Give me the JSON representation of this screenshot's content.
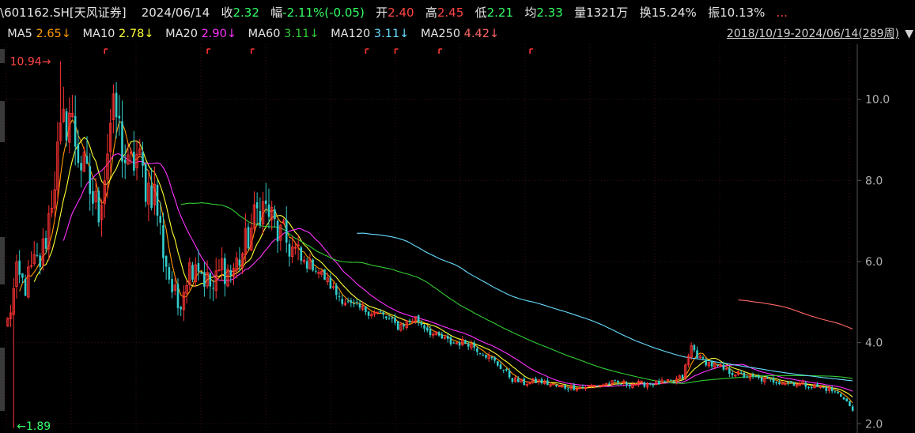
{
  "header": {
    "prefix": "\\",
    "code_name": "601162.SH[天风证券]",
    "date": "2024/06/14",
    "close_label": "收",
    "close_value": "2.32",
    "change_label": "幅",
    "change_value": "-2.11%(-0.05)",
    "open_label": "开",
    "open_value": "2.40",
    "high_label": "高",
    "high_value": "2.45",
    "low_label": "低",
    "low_value": "2.21",
    "avg_label": "均",
    "avg_value": "2.33",
    "volume_label": "量",
    "volume_value": "1321万",
    "turnover_label": "换",
    "turnover_value": "15.24%",
    "amplitude_label": "振",
    "amplitude_value": "10.13%",
    "more": "..."
  },
  "ma_legend": [
    {
      "label": "MA5",
      "value": "2.65↓",
      "color": "#ff9900"
    },
    {
      "label": "MA10",
      "value": "2.78↓",
      "color": "#ffff33"
    },
    {
      "label": "MA20",
      "value": "2.90↓",
      "color": "#ff33ff"
    },
    {
      "label": "MA60",
      "value": "3.11↓",
      "color": "#33cc33"
    },
    {
      "label": "MA120",
      "value": "3.11↓",
      "color": "#66ddff"
    },
    {
      "label": "MA250",
      "value": "4.42↓",
      "color": "#ff6666"
    }
  ],
  "range": {
    "text": "2018/10/19-2024/06/14(289周)",
    "arrow": "▼"
  },
  "chart_data": {
    "type": "candlestick",
    "period": "weekly",
    "bars": 289,
    "ylim": [
      1.85,
      11.2
    ],
    "y_ticks": [
      "10.0",
      "8.0",
      "6.0",
      "4.0",
      "2.0"
    ],
    "y_tick_values": [
      10,
      8,
      6,
      4,
      2
    ],
    "max_marker": {
      "value": "10.94",
      "arrow": "→",
      "index": 18
    },
    "min_marker": {
      "value": "1.89",
      "arrow": "←",
      "index": 2
    },
    "colors": {
      "up": "#ff3333",
      "down": "#33cccc",
      "grid": "#3a1010",
      "axis": "#555555",
      "tick_text": "#b0b0b0",
      "marker": "#ff3333",
      "max_text": "#ff4444",
      "min_text": "#33ff66"
    },
    "event_flag_indices": [
      33,
      68,
      83,
      122,
      132,
      147,
      178
    ],
    "close_anchors": [
      [
        0,
        4.5
      ],
      [
        3,
        5.6
      ],
      [
        6,
        5.4
      ],
      [
        9,
        5.9
      ],
      [
        11,
        6.0
      ],
      [
        13,
        6.6
      ],
      [
        15,
        7.6
      ],
      [
        17,
        8.6
      ],
      [
        19,
        9.3
      ],
      [
        21,
        9.7
      ],
      [
        23,
        9.0
      ],
      [
        25,
        8.4
      ],
      [
        27,
        8.0
      ],
      [
        29,
        7.5
      ],
      [
        31,
        7.3
      ],
      [
        33,
        8.2
      ],
      [
        35,
        9.4
      ],
      [
        37,
        9.6
      ],
      [
        39,
        8.8
      ],
      [
        41,
        8.2
      ],
      [
        44,
        8.6
      ],
      [
        47,
        7.9
      ],
      [
        50,
        7.7
      ],
      [
        53,
        6.3
      ],
      [
        56,
        5.3
      ],
      [
        58,
        4.9
      ],
      [
        61,
        5.7
      ],
      [
        64,
        6.1
      ],
      [
        67,
        5.6
      ],
      [
        70,
        5.3
      ],
      [
        73,
        5.9
      ],
      [
        76,
        5.7
      ],
      [
        80,
        6.2
      ],
      [
        84,
        7.0
      ],
      [
        86,
        7.4
      ],
      [
        89,
        7.2
      ],
      [
        92,
        6.7
      ],
      [
        96,
        6.4
      ],
      [
        100,
        6.0
      ],
      [
        104,
        5.9
      ],
      [
        108,
        5.6
      ],
      [
        112,
        5.2
      ],
      [
        117,
        4.9
      ],
      [
        122,
        4.8
      ],
      [
        127,
        4.7
      ],
      [
        133,
        4.4
      ],
      [
        139,
        4.6
      ],
      [
        145,
        4.2
      ],
      [
        151,
        4.0
      ],
      [
        157,
        4.0
      ],
      [
        163,
        3.7
      ],
      [
        168,
        3.4
      ],
      [
        172,
        3.1
      ],
      [
        176,
        3.0
      ],
      [
        181,
        3.05
      ],
      [
        188,
        2.9
      ],
      [
        196,
        2.9
      ],
      [
        206,
        3.0
      ],
      [
        216,
        2.98
      ],
      [
        226,
        3.02
      ],
      [
        230,
        3.15
      ],
      [
        233,
        3.9
      ],
      [
        236,
        3.6
      ],
      [
        240,
        3.45
      ],
      [
        245,
        3.3
      ],
      [
        250,
        3.2
      ],
      [
        256,
        3.1
      ],
      [
        262,
        3.05
      ],
      [
        268,
        3.0
      ],
      [
        273,
        2.95
      ],
      [
        280,
        2.85
      ],
      [
        285,
        2.65
      ],
      [
        288,
        2.32
      ]
    ],
    "ma_series": [
      {
        "label": "MA5",
        "period": 5,
        "color": "#ff9900"
      },
      {
        "label": "MA10",
        "period": 10,
        "color": "#ffff33"
      },
      {
        "label": "MA20",
        "period": 20,
        "color": "#ff33ff"
      },
      {
        "label": "MA60",
        "period": 60,
        "color": "#33cc33"
      },
      {
        "label": "MA120",
        "period": 120,
        "color": "#66ddff"
      },
      {
        "label": "MA250",
        "period": 250,
        "color": "#ff6666"
      }
    ]
  }
}
